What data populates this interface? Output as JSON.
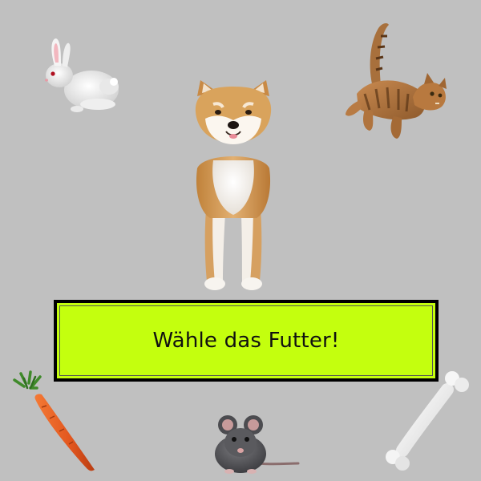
{
  "prompt": {
    "text": "Wähle das Futter!"
  },
  "colors": {
    "background": "#c0c0c0",
    "prompt_fill": "#c4ff0e",
    "prompt_border": "#000000"
  },
  "animals": [
    {
      "name": "rabbit",
      "icon": "rabbit-icon"
    },
    {
      "name": "cat",
      "icon": "cat-icon"
    }
  ],
  "pet": {
    "name": "dog",
    "icon": "shiba-dog-icon"
  },
  "food_options": [
    {
      "name": "carrot",
      "icon": "carrot-icon"
    },
    {
      "name": "mouse",
      "icon": "mouse-icon"
    },
    {
      "name": "bone",
      "icon": "bone-icon"
    }
  ]
}
